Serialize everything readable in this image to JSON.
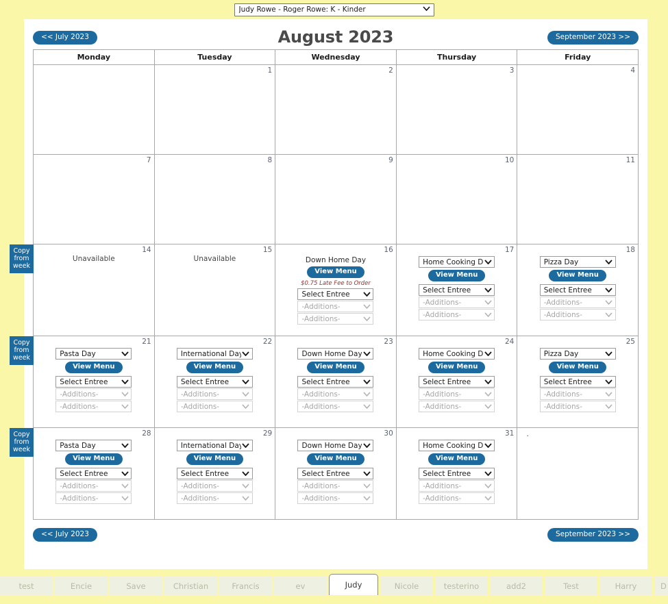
{
  "topbar": {
    "student_selector_value": "Judy Rowe - Roger Rowe: K - Kinder",
    "caret": "⌵"
  },
  "header": {
    "month_title": "August 2023",
    "prev_label": "<< July 2023",
    "next_label": "September 2023 >>"
  },
  "footer": {
    "prev_label": "<< July 2023",
    "next_label": "September 2023 >>"
  },
  "calendar": {
    "weekday_headers": [
      "Monday",
      "Tuesday",
      "Wednesday",
      "Thursday",
      "Friday"
    ],
    "copy_week_label": "Copy from week",
    "view_menu_label": "View Menu",
    "select_entree_label": "Select Entree",
    "additions_label": "-Additions-",
    "unavailable_label": "Unavailable",
    "late_fee_label": "$0.75 Late Fee to Order",
    "dot_label": ".",
    "weeks": [
      {
        "type": "empty",
        "days": [
          {
            "num": ""
          },
          {
            "num": "1"
          },
          {
            "num": "2"
          },
          {
            "num": "3"
          },
          {
            "num": "4"
          }
        ]
      },
      {
        "type": "empty",
        "days": [
          {
            "num": "7"
          },
          {
            "num": "8"
          },
          {
            "num": "9"
          },
          {
            "num": "10"
          },
          {
            "num": "11"
          }
        ]
      },
      {
        "type": "content",
        "copy_week": true,
        "days": [
          {
            "num": "14",
            "state": "unavailable"
          },
          {
            "num": "15",
            "state": "unavailable"
          },
          {
            "num": "16",
            "state": "text-menu",
            "menu": "Down Home Day",
            "late_fee": true
          },
          {
            "num": "17",
            "state": "select-menu",
            "menu": "Home Cooking Day"
          },
          {
            "num": "18",
            "state": "select-menu",
            "menu": "Pizza Day"
          }
        ]
      },
      {
        "type": "content",
        "copy_week": true,
        "days": [
          {
            "num": "21",
            "state": "select-menu",
            "menu": "Pasta Day"
          },
          {
            "num": "22",
            "state": "select-menu",
            "menu": "International Day"
          },
          {
            "num": "23",
            "state": "select-menu",
            "menu": "Down Home Day"
          },
          {
            "num": "24",
            "state": "select-menu",
            "menu": "Home Cooking Day"
          },
          {
            "num": "25",
            "state": "select-menu",
            "menu": "Pizza Day"
          }
        ]
      },
      {
        "type": "content",
        "copy_week": true,
        "days": [
          {
            "num": "28",
            "state": "select-menu",
            "menu": "Pasta Day"
          },
          {
            "num": "29",
            "state": "select-menu",
            "menu": "International Day"
          },
          {
            "num": "30",
            "state": "select-menu",
            "menu": "Down Home Day"
          },
          {
            "num": "31",
            "state": "select-menu",
            "menu": "Home Cooking Day"
          },
          {
            "num": "",
            "state": "dot"
          }
        ]
      }
    ]
  },
  "tabs": [
    {
      "label": "test",
      "active": false
    },
    {
      "label": "Encie",
      "active": false
    },
    {
      "label": "Save",
      "active": false
    },
    {
      "label": "Christian",
      "active": false
    },
    {
      "label": "Francis",
      "active": false
    },
    {
      "label": "ev",
      "active": false
    },
    {
      "label": "Judy",
      "active": true
    },
    {
      "label": "Nicole",
      "active": false
    },
    {
      "label": "testerino",
      "active": false
    },
    {
      "label": "add2",
      "active": false
    },
    {
      "label": "Test",
      "active": false
    },
    {
      "label": "Harry",
      "active": false
    },
    {
      "label": "D",
      "active": false,
      "clipped": true
    }
  ],
  "colors": {
    "page_background": "#faf7a8",
    "accent_blue": "#1d6a9e",
    "late_fee_red": "#9c2f2f",
    "tab_inactive": "#eef0e2"
  }
}
